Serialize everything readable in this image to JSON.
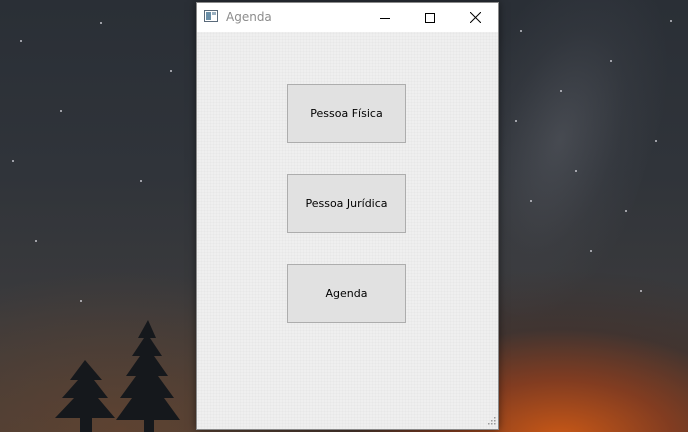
{
  "window": {
    "title": "Agenda",
    "controls": [
      "minimize-icon",
      "maximize-icon",
      "close-icon"
    ]
  },
  "buttons": {
    "pessoa_fisica": "Pessoa Física",
    "pessoa_juridica": "Pessoa Jurídica",
    "agenda": "Agenda"
  },
  "colors": {
    "window_bg": "#f0f0f0",
    "button_bg": "#e1e1e1",
    "button_border": "#adadad",
    "title_text": "#8c8c8c"
  }
}
